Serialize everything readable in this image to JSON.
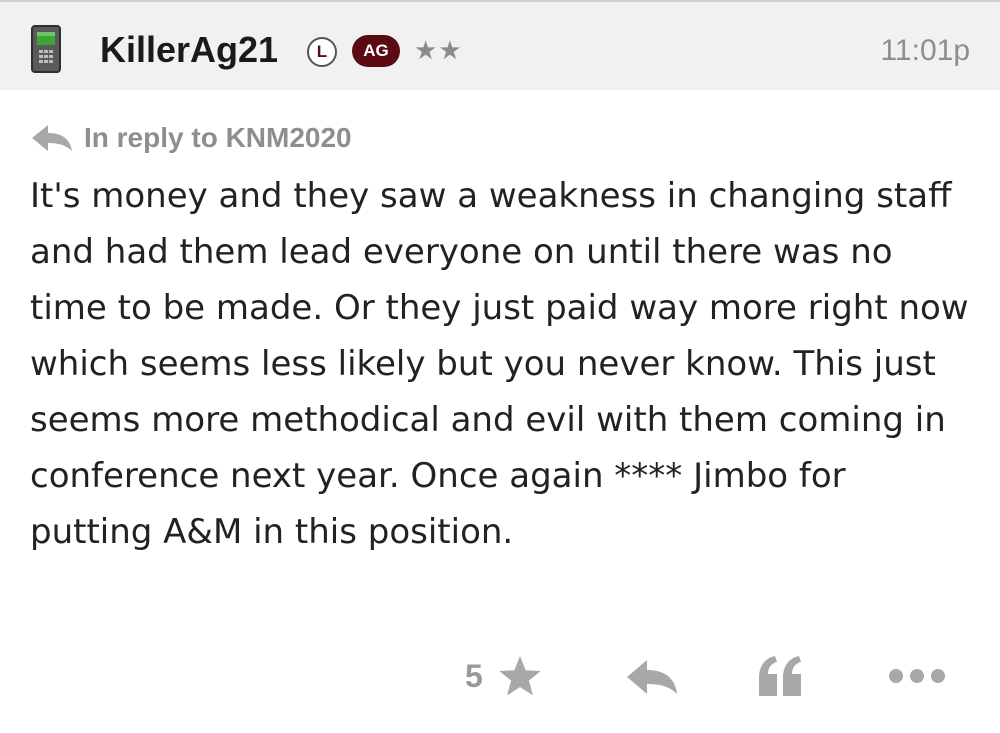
{
  "post": {
    "author": "KillerAg21",
    "badge_letter": "L",
    "badge_team": "AG",
    "rank_stars": "★★",
    "time": "11:01p",
    "in_reply_to": "In reply to KNM2020",
    "body": "It's money and they saw a weakness in changing staff and had them lead everyone on until there was no time to be made. Or they just paid way more right now which seems less likely but you never know. This just seems more methodical and evil with them coming in conference next year. Once again **** Jimbo for putting A&M in this position."
  },
  "actions": {
    "like_count": "5",
    "like_icon": "star-icon",
    "reply_icon": "reply-arrow-icon",
    "quote_icon": "quote-icon",
    "more_icon": "more-dots-icon"
  },
  "colors": {
    "header_bg": "#f1f1f1",
    "team_maroon": "#5c0a12",
    "muted_gray": "#9a9a9a",
    "phone_green": "#3fa33a"
  }
}
